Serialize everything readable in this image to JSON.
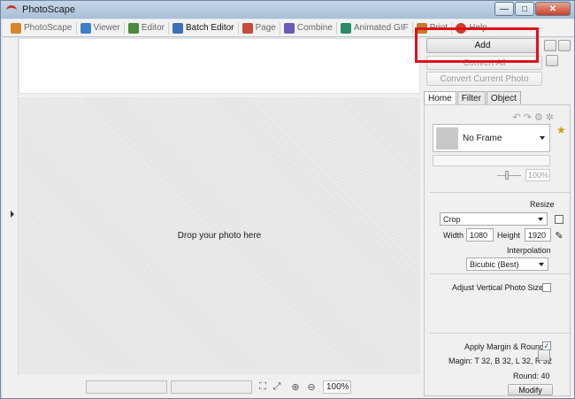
{
  "window": {
    "title": "PhotoScape",
    "minimize_glyph": "—",
    "maximize_glyph": "□",
    "close_glyph": "✕"
  },
  "tabs": [
    {
      "label": "PhotoScape",
      "icon": "photoscape-icon",
      "color": "#d9862a"
    },
    {
      "label": "Viewer",
      "icon": "viewer-icon",
      "color": "#3f7fc8"
    },
    {
      "label": "Editor",
      "icon": "editor-icon",
      "color": "#4a8a3a"
    },
    {
      "label": "Batch Editor",
      "icon": "batch-editor-icon",
      "color": "#3f6fb8"
    },
    {
      "label": "Page",
      "icon": "page-icon",
      "color": "#c84a3a"
    },
    {
      "label": "Combine",
      "icon": "combine-icon",
      "color": "#6a5ab8"
    },
    {
      "label": "Animated GIF",
      "icon": "animated-gif-icon",
      "color": "#2a8a6a"
    },
    {
      "label": "Print",
      "icon": "print-icon",
      "color": "#c87a2a"
    },
    {
      "label": "Help",
      "icon": "help-icon",
      "color": "#d43a2a"
    }
  ],
  "active_tab": "Batch Editor",
  "drop_area": {
    "text": "Drop your photo here"
  },
  "buttons": {
    "add": "Add",
    "convert_all": "Convert All",
    "convert_current": "Convert Current Photo",
    "modify": "Modify"
  },
  "side_tabs": [
    "Home",
    "Filter",
    "Object"
  ],
  "frame": {
    "selected": "No Frame",
    "percent": "100%"
  },
  "resize": {
    "label": "Resize",
    "mode": "Crop",
    "width_label": "Width",
    "width_value": "1080",
    "height_label": "Height",
    "height_value": "1920",
    "interpolation_label": "Interpolation",
    "interpolation_value": "Bicubic (Best)"
  },
  "adjust_vertical": {
    "label": "Adjust Vertical Photo Size",
    "checked": false
  },
  "margin": {
    "label": "Apply Margin & Round",
    "checked": true,
    "detail": "Magin: T 32, B 32, L 32, R 32",
    "round": "Round: 40"
  },
  "status": {
    "zoom": "100%"
  },
  "colors": {
    "highlight": "#e0101a",
    "star": "#c9a000"
  }
}
